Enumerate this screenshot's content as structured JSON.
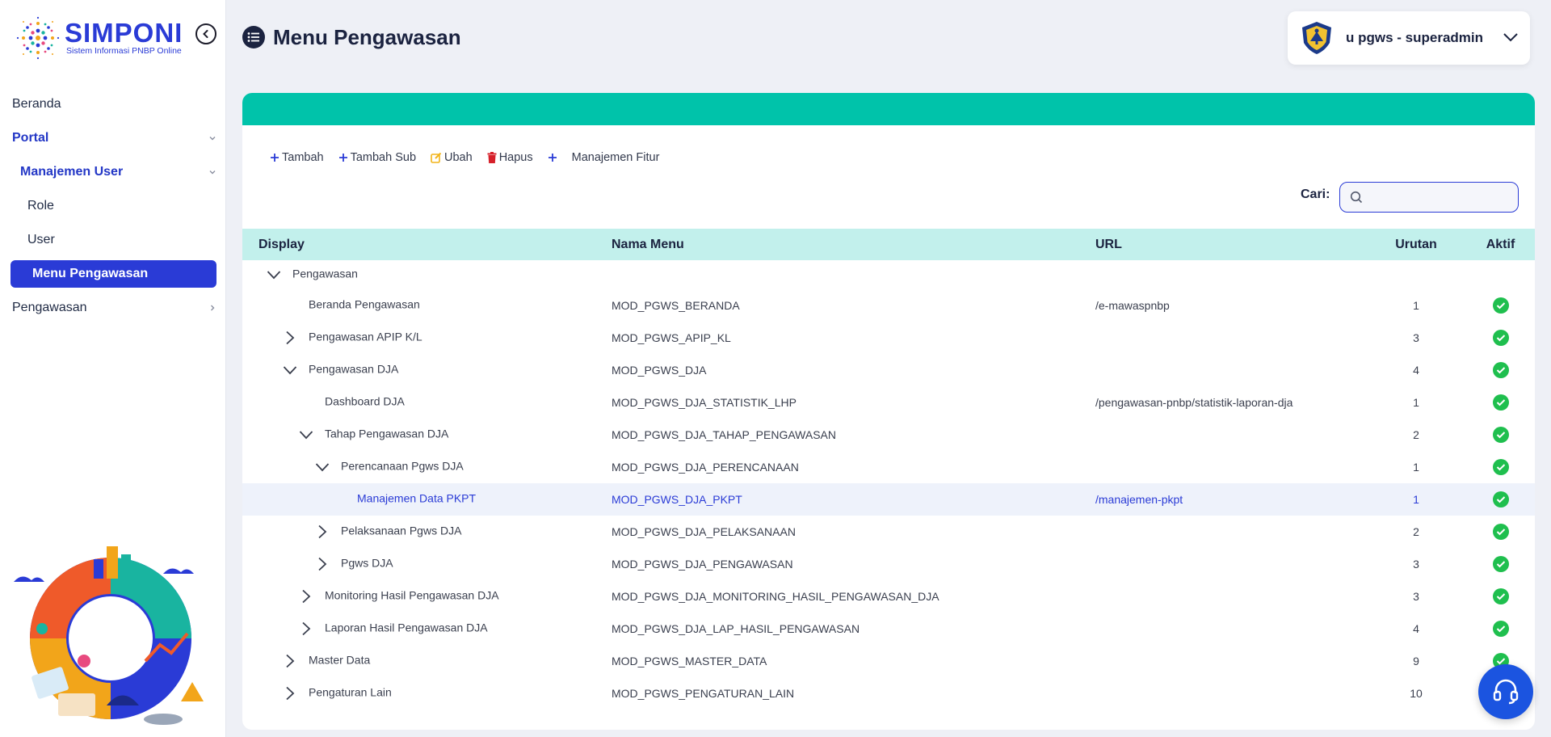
{
  "app": {
    "name": "SIMPONI",
    "subtitle": "Sistem Informasi PNBP Online"
  },
  "sidebar": {
    "items": [
      {
        "label": "Beranda"
      },
      {
        "label": "Portal"
      },
      {
        "label": "Manajemen User"
      },
      {
        "label": "Role"
      },
      {
        "label": "User"
      },
      {
        "label": "Menu Pengawasan"
      },
      {
        "label": "Pengawasan"
      }
    ]
  },
  "header": {
    "title": "Menu Pengawasan",
    "user": "u pgws - superadmin"
  },
  "toolbar": {
    "tambah": "Tambah",
    "tambah_sub": "Tambah Sub",
    "ubah": "Ubah",
    "hapus": "Hapus",
    "manajemen_fitur": "Manajemen Fitur"
  },
  "search": {
    "label": "Cari:",
    "placeholder": "",
    "value": ""
  },
  "table": {
    "columns": {
      "display": "Display",
      "nama": "Nama Menu",
      "url": "URL",
      "urutan": "Urutan",
      "aktif": "Aktif"
    },
    "rows": [
      {
        "display": "Pengawasan",
        "nama": "",
        "url": "",
        "urutan": "",
        "aktif": false
      },
      {
        "display": "Beranda Pengawasan",
        "nama": "MOD_PGWS_BERANDA",
        "url": "/e-mawaspnbp",
        "urutan": "1",
        "aktif": true
      },
      {
        "display": "Pengawasan APIP K/L",
        "nama": "MOD_PGWS_APIP_KL",
        "url": "",
        "urutan": "3",
        "aktif": true
      },
      {
        "display": "Pengawasan DJA",
        "nama": "MOD_PGWS_DJA",
        "url": "",
        "urutan": "4",
        "aktif": true
      },
      {
        "display": "Dashboard DJA",
        "nama": "MOD_PGWS_DJA_STATISTIK_LHP",
        "url": "/pengawasan-pnbp/statistik-laporan-dja",
        "urutan": "1",
        "aktif": true
      },
      {
        "display": "Tahap Pengawasan DJA",
        "nama": "MOD_PGWS_DJA_TAHAP_PENGAWASAN",
        "url": "",
        "urutan": "2",
        "aktif": true
      },
      {
        "display": "Perencanaan Pgws DJA",
        "nama": "MOD_PGWS_DJA_PERENCANAAN",
        "url": "",
        "urutan": "1",
        "aktif": true
      },
      {
        "display": "Manajemen Data PKPT",
        "nama": "MOD_PGWS_DJA_PKPT",
        "url": "/manajemen-pkpt",
        "urutan": "1",
        "aktif": true
      },
      {
        "display": "Pelaksanaan Pgws DJA",
        "nama": "MOD_PGWS_DJA_PELAKSANAAN",
        "url": "",
        "urutan": "2",
        "aktif": true
      },
      {
        "display": "Pgws DJA",
        "nama": "MOD_PGWS_DJA_PENGAWASAN",
        "url": "",
        "urutan": "3",
        "aktif": true
      },
      {
        "display": "Monitoring Hasil Pengawasan DJA",
        "nama": "MOD_PGWS_DJA_MONITORING_HASIL_PENGAWASAN_DJA",
        "url": "",
        "urutan": "3",
        "aktif": true
      },
      {
        "display": "Laporan Hasil Pengawasan DJA",
        "nama": "MOD_PGWS_DJA_LAP_HASIL_PENGAWASAN",
        "url": "",
        "urutan": "4",
        "aktif": true
      },
      {
        "display": "Master Data",
        "nama": "MOD_PGWS_MASTER_DATA",
        "url": "",
        "urutan": "9",
        "aktif": true
      },
      {
        "display": "Pengaturan Lain",
        "nama": "MOD_PGWS_PENGATURAN_LAIN",
        "url": "",
        "urutan": "10",
        "aktif": false
      }
    ]
  },
  "colors": {
    "brand": "#2a3bd6",
    "band": "#00c3aa",
    "header_row": "#c2f0ec",
    "active_check": "#1fbf4e"
  },
  "icons": {
    "collapse": "chevron-left-circle-icon",
    "title": "list-icon",
    "help": "headset-icon",
    "search": "search-icon"
  }
}
